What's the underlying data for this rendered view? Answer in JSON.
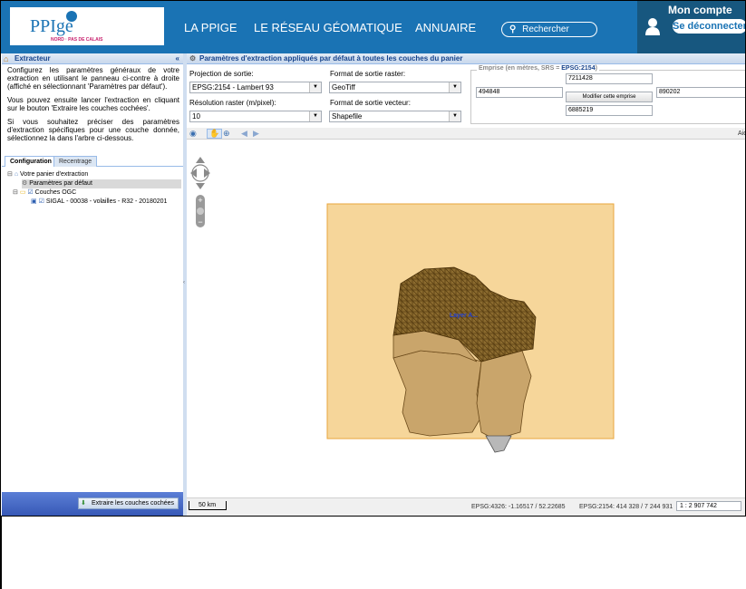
{
  "header": {
    "logo_text": "PPIge",
    "logo_sub": "NORD · PAS DE CALAIS",
    "nav": [
      "LA PPIGE",
      "LE RÉSEAU GÉOMATIQUE",
      "ANNUAIRE"
    ],
    "search_placeholder": "Rechercher",
    "account_title": "Mon compte",
    "logout_label": "Se déconnecter"
  },
  "left_panel": {
    "title": "Extracteur",
    "paragraphs": [
      "Configurez les paramètres généraux de votre extraction en utilisant le panneau ci-contre à droite (affiché en sélectionnant 'Paramètres par défaut').",
      "Vous pouvez ensuite lancer l'extraction en cliquant sur le bouton 'Extraire les couches cochées'.",
      "Si vous souhaitez préciser des paramètres d'extraction spécifiques pour une couche donnée, sélectionnez la dans l'arbre ci-dessous."
    ],
    "tabs": [
      "Configuration",
      "Recentrage"
    ],
    "tree": {
      "root": "Votre panier d'extraction",
      "default_params": "Paramètres par défaut",
      "group": "Couches OGC",
      "layer": "SIGAL - 00038 - volailles - R32 - 20180201"
    },
    "extract_button": "Extraire les couches cochées"
  },
  "right_panel": {
    "title": "Paramètres d'extraction appliqués par défaut à toutes les couches du panier",
    "projection_label": "Projection de sortie:",
    "projection_value": "EPSG:2154 - Lambert 93",
    "raster_format_label": "Format de sortie raster:",
    "raster_format_value": "GeoTiff",
    "resolution_label": "Résolution raster (m/pixel):",
    "resolution_value": "10",
    "vector_format_label": "Format de sortie vecteur:",
    "vector_format_value": "Shapefile",
    "emprise_title": "Emprise (en mètres, SRS = ",
    "emprise_srs": "EPSG:2154",
    "emprise_close": ")",
    "north": "7211428",
    "west": "494848",
    "east": "890202",
    "south": "6885219",
    "modify_button": "Modifier cette emprise",
    "aide": "Aide"
  },
  "map": {
    "feature_label": "Layer A...",
    "scalebar": "50 km",
    "coords_4326": "EPSG:4326: -1.16517 / 52.22685",
    "coords_2154": "EPSG:2154: 414 328 / 7 244 931",
    "scale": "1 : 2 907 742"
  },
  "colors": {
    "header_blue": "#1a73b4",
    "account_bg": "#17577f",
    "extent_fill": "#f6d69a",
    "region_fill": "#c9a56b",
    "dense_fill": "#8a6a2e"
  }
}
